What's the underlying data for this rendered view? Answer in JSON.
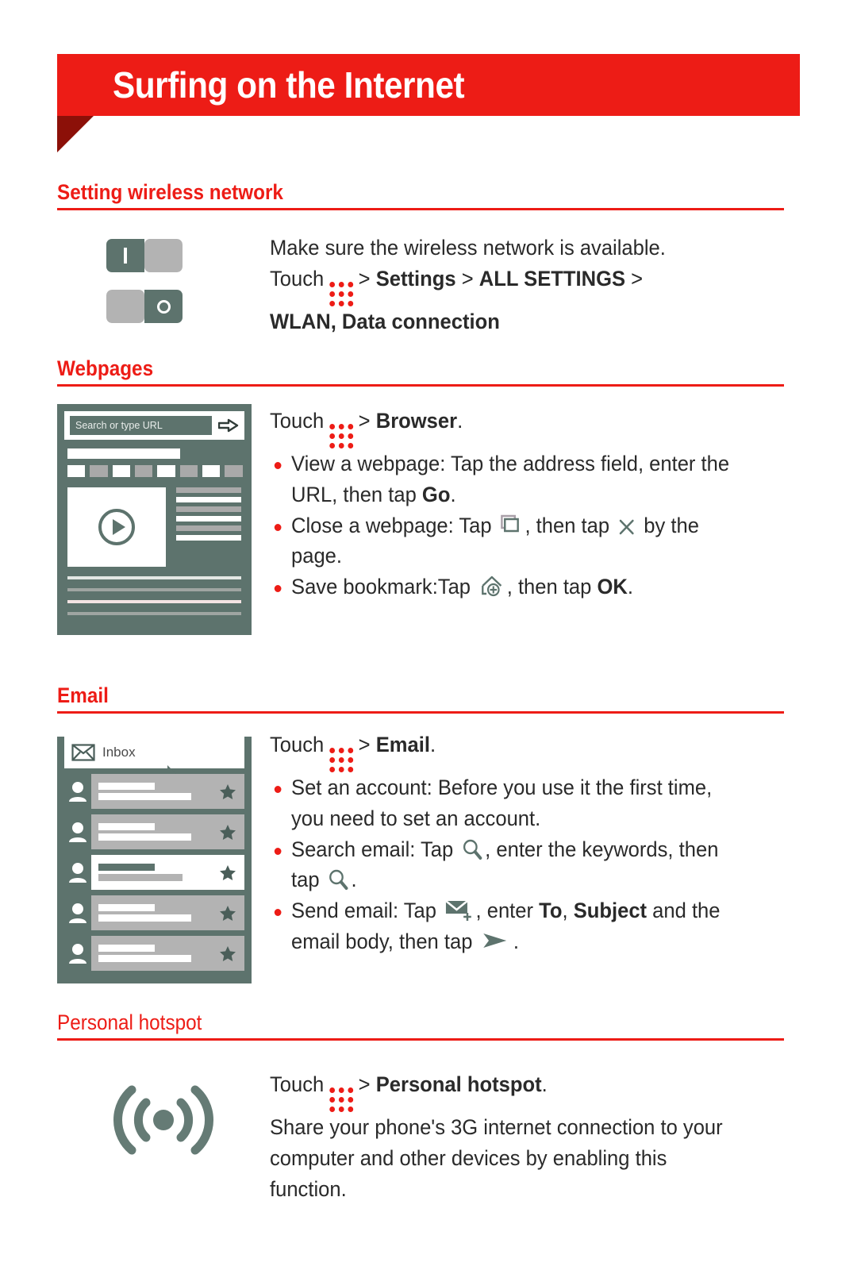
{
  "colors": {
    "brand_red": "#ed1c16",
    "fold_dark_red": "#8c1008",
    "slate": "#5d736d",
    "gray": "#b3b3b3",
    "text": "#2a2a2a"
  },
  "header": {
    "title": "Surfing on the Internet"
  },
  "sections": {
    "wireless": {
      "heading": "Setting wireless network",
      "toggle_on_label": "I",
      "toggle_off_label": "O",
      "line1": "Make sure the wireless network is available.",
      "touch_label": "Touch",
      "chevron": ">",
      "settings": "Settings",
      "all_settings": "ALL SETTINGS",
      "wlan": "WLAN",
      "comma": ",",
      "data_connection": "Data connection"
    },
    "webpages": {
      "heading": "Webpages",
      "touch_label": "Touch",
      "chevron": ">",
      "app": "Browser",
      "period": ".",
      "mock": {
        "address_placeholder": "Search or type URL",
        "tab_colors": [
          "w",
          "g",
          "w",
          "g",
          "w",
          "g",
          "w",
          "g"
        ],
        "side_lines": [
          "g",
          "w",
          "g",
          "w",
          "g",
          "w"
        ]
      },
      "bullets": [
        {
          "pre": "View a webpage: Tap the address field, enter the",
          "line2_pre": "URL, then tap ",
          "bold": "Go",
          "post": "."
        },
        {
          "pre": "Close a webpage: Tap ",
          "icon1": "tabs-icon",
          "mid": ", then tap ",
          "icon2": "close-x-icon",
          "post": " by the",
          "line2": "page."
        },
        {
          "pre": "Save bookmark:Tap ",
          "icon1": "add-bookmark-icon",
          "mid": ", then tap ",
          "bold": "OK",
          "post": "."
        }
      ]
    },
    "email": {
      "heading": "Email",
      "touch_label": "Touch",
      "chevron": ">",
      "app": "Email",
      "period": ".",
      "mock": {
        "inbox_label": "Inbox",
        "rows": [
          {
            "style": "gray",
            "top": "white",
            "bottom": "white"
          },
          {
            "style": "gray",
            "top": "white",
            "bottom": "white"
          },
          {
            "style": "white",
            "top": "dark",
            "bottom": "gray"
          },
          {
            "style": "gray",
            "top": "white",
            "bottom": "white"
          },
          {
            "style": "gray",
            "top": "white",
            "bottom": "white"
          }
        ]
      },
      "bullets": [
        {
          "pre": "Set an account: Before you use it the first time,",
          "line2": "you need to set an account."
        },
        {
          "pre": "Search email: Tap ",
          "icon1": "search-icon",
          "mid": ", enter the keywords, then",
          "line2_pre": "tap ",
          "icon2": "search-icon",
          "post": "."
        },
        {
          "pre": "Send email: Tap ",
          "icon1": "compose-mail-icon",
          "mid": ", enter ",
          "bold1": "To",
          "comma": ", ",
          "bold2": "Subject",
          "post": " and the",
          "line2_pre": "email body, then tap ",
          "icon2": "send-icon",
          "line2_post": "."
        }
      ]
    },
    "hotspot": {
      "heading": "Personal hotspot",
      "touch_label": "Touch",
      "chevron": ">",
      "app": "Personal hotspot",
      "period": ".",
      "body_line1": "Share your phone's 3G internet connection to your",
      "body_line2": "computer and other devices by enabling this",
      "body_line3": "function."
    }
  }
}
